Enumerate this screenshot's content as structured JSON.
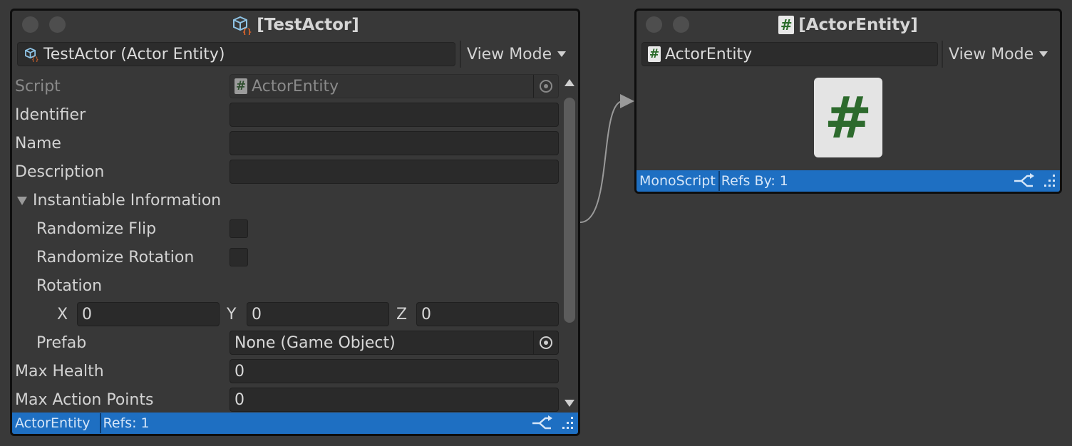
{
  "left_node": {
    "title": "[TestActor]",
    "title_icon": "prefab-icon",
    "object_field": "TestActor (Actor Entity)",
    "object_icon": "prefab-icon",
    "view_mode": "View Mode",
    "fields": {
      "script": {
        "label": "Script",
        "value": "ActorEntity"
      },
      "identifier": {
        "label": "Identifier",
        "value": ""
      },
      "name": {
        "label": "Name",
        "value": ""
      },
      "description": {
        "label": "Description",
        "value": ""
      },
      "instantiable": {
        "label": "Instantiable Information",
        "expanded": true
      },
      "randomize_flip": {
        "label": "Randomize Flip",
        "checked": false
      },
      "randomize_rotation": {
        "label": "Randomize Rotation",
        "checked": false
      },
      "rotation": {
        "label": "Rotation",
        "x_label": "X",
        "x": "0",
        "y_label": "Y",
        "y": "0",
        "z_label": "Z",
        "z": "0"
      },
      "prefab": {
        "label": "Prefab",
        "value": "None (Game Object)"
      },
      "max_health": {
        "label": "Max Health",
        "value": "0"
      },
      "max_action_points": {
        "label": "Max Action Points",
        "value": "0"
      }
    },
    "footer": {
      "type": "ActorEntity",
      "refs": "Refs: 1"
    }
  },
  "right_node": {
    "title": "[ActorEntity]",
    "title_icon": "csharp-script-icon",
    "object_field": "ActorEntity",
    "object_icon": "csharp-script-icon",
    "view_mode": "View Mode",
    "preview_glyph": "#",
    "footer": {
      "type": "MonoScript",
      "refs": "Refs By: 1"
    }
  },
  "colors": {
    "footer_accent": "#1e6fc2",
    "background": "#393939",
    "node_body": "#383838"
  }
}
